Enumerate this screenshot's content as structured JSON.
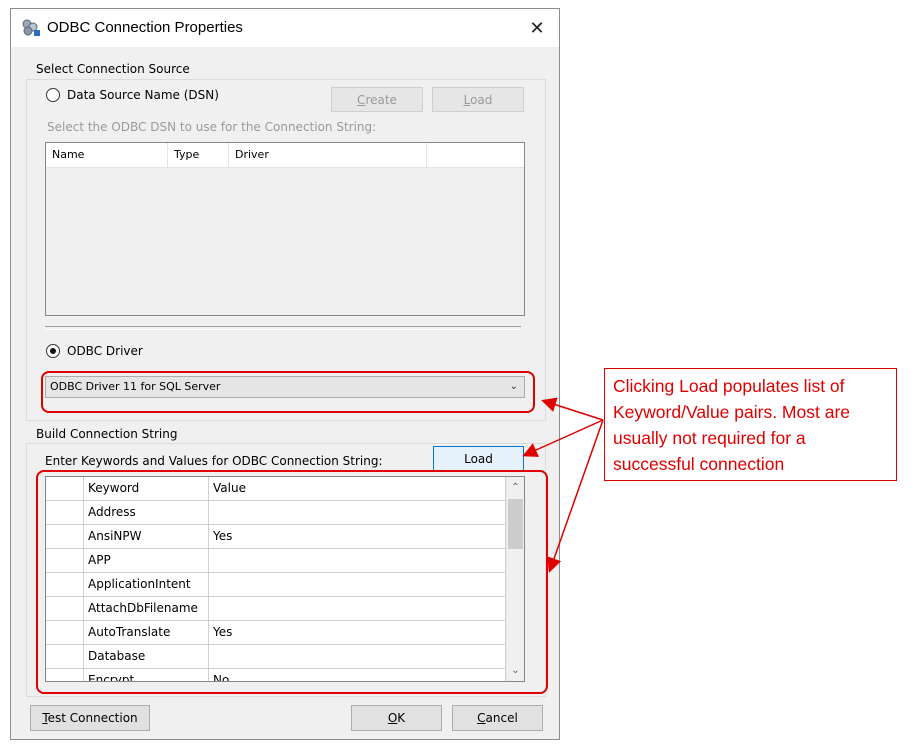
{
  "dialog": {
    "title": "ODBC Connection Properties",
    "close_glyph": "✕"
  },
  "connection_source": {
    "group_label": "Select Connection Source",
    "dsn_radio_label": "Data Source Name (DSN)",
    "dsn_selected": false,
    "create_button": "Create",
    "load_button": "Load",
    "dsn_prompt": "Select the ODBC DSN to use for the Connection String:",
    "dsn_columns": [
      "Name",
      "Type",
      "Driver"
    ],
    "driver_radio_label": "ODBC Driver",
    "driver_selected": true,
    "driver_selected_value": "ODBC Driver 11 for SQL Server"
  },
  "build": {
    "group_label": "Build Connection String",
    "prompt": "Enter Keywords and Values for ODBC Connection String:",
    "load_button": "Load",
    "columns": [
      "Keyword",
      "Value"
    ],
    "rows": [
      {
        "keyword": "Address",
        "value": ""
      },
      {
        "keyword": "AnsiNPW",
        "value": "Yes"
      },
      {
        "keyword": "APP",
        "value": ""
      },
      {
        "keyword": "ApplicationIntent",
        "value": ""
      },
      {
        "keyword": "AttachDbFilename",
        "value": ""
      },
      {
        "keyword": "AutoTranslate",
        "value": "Yes"
      },
      {
        "keyword": "Database",
        "value": ""
      },
      {
        "keyword": "Encrypt",
        "value": "No"
      }
    ]
  },
  "footer": {
    "test_button": "Test Connection",
    "ok_button": "OK",
    "cancel_button": "Cancel"
  },
  "annotation": {
    "callout_text": "Clicking Load populates list of Keyword/Value pairs. Most are usually not required for a successful connection",
    "color": "#e00000"
  }
}
